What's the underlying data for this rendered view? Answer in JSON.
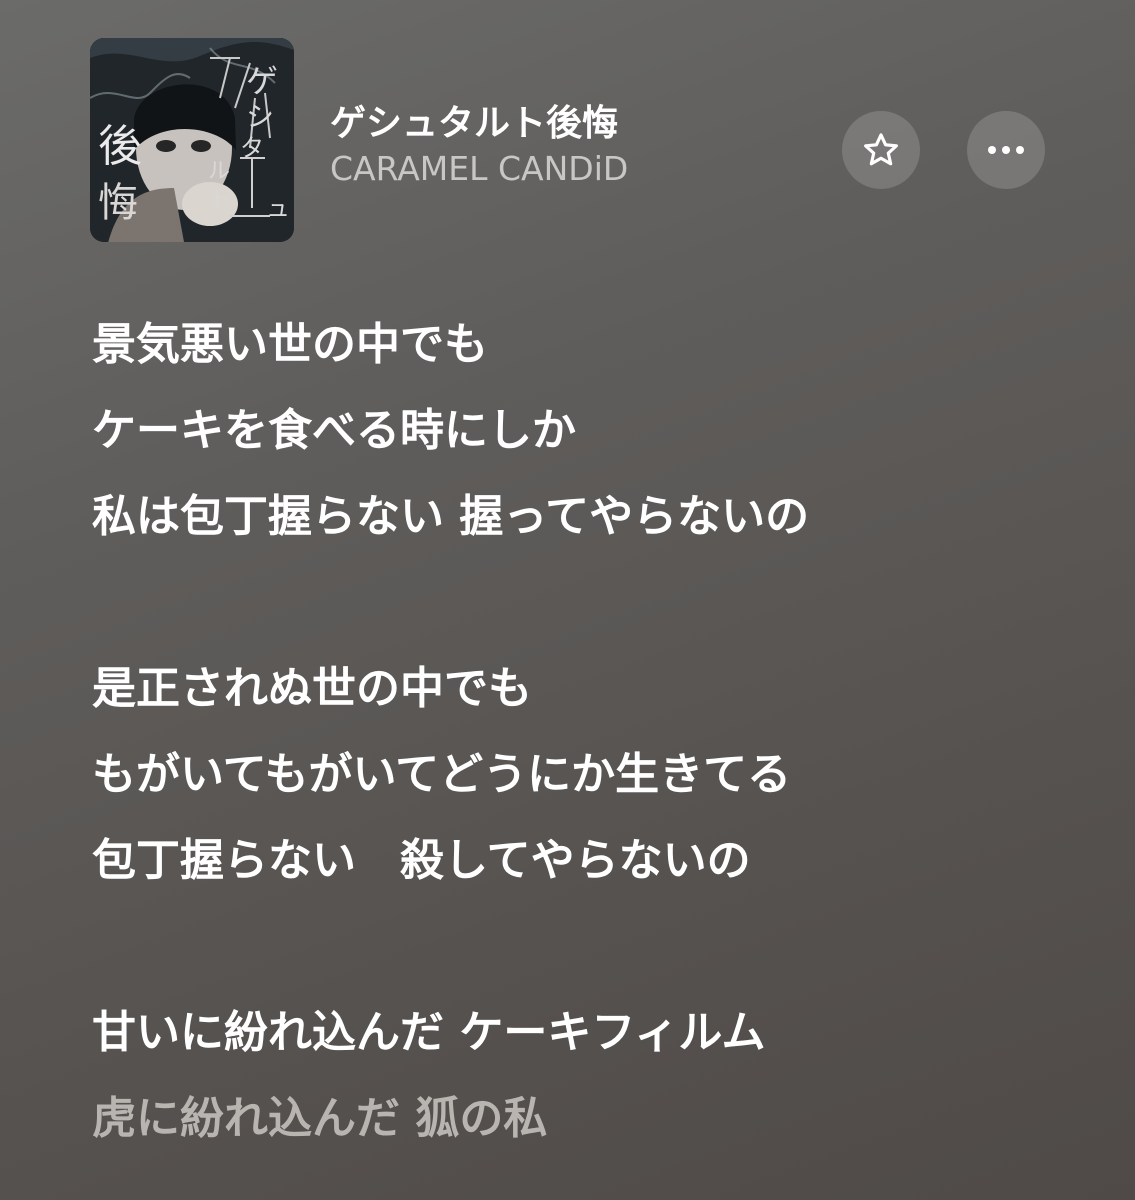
{
  "track": {
    "title": "ゲシュタルト後悔",
    "artist": "CARAMEL CANDiD",
    "artwork_text": [
      "後",
      "悔",
      "ゲ",
      "シ",
      "ュ",
      "タ",
      "ル",
      "ト"
    ]
  },
  "controls": {
    "favorite_icon": "star-icon",
    "more_icon": "ellipsis-icon"
  },
  "lyrics": {
    "line_1": "景気悪い世の中でも",
    "line_2": "ケーキを食べる時にしか",
    "line_3": "私は包丁握らない 握ってやらないの",
    "line_4": "是正されぬ世の中でも",
    "line_5": "もがいてもがいてどうにか生きてる",
    "line_6": "包丁握らない　殺してやらないの",
    "line_7": "甘いに紛れ込んだ ケーキフィルム",
    "line_8": "虎に紛れ込んだ 狐の私"
  },
  "colors": {
    "background_top": "#6b6b69",
    "background_bottom": "#4f4a47",
    "active_lyric": "#ffffff",
    "inactive_lyric": "#b8b4b0",
    "artist_text": "#c9c7c5"
  }
}
